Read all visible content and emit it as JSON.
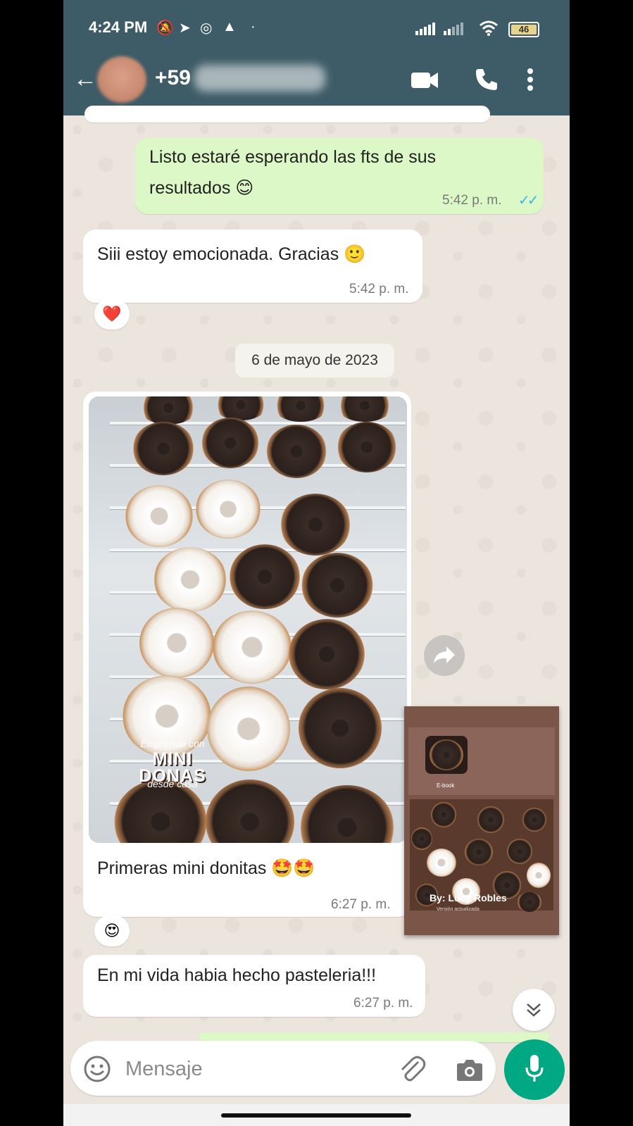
{
  "status_bar": {
    "time": "4:24 PM",
    "battery": "46"
  },
  "header": {
    "contact_prefix": "+59"
  },
  "messages": [
    {
      "text_line1": "Listo estaré esperando las fts de sus",
      "text_line2": "resultados 😊",
      "time": "5:42 p. m.",
      "ticks": "✓✓"
    },
    {
      "text": "Siii estoy emocionada. Gracias 🙂",
      "time": "5:42 p. m.",
      "reaction": "❤️"
    },
    {
      "caption": "Primeras mini donitas 🤩🤩",
      "time": "6:27 p. m.",
      "reaction": "😍"
    },
    {
      "text": "En mi vida habia hecho pasteleria!!!",
      "time": "6:27 p. m."
    }
  ],
  "date_chip": "6 de mayo de 2023",
  "book": {
    "line1": "Emprende con",
    "line2a": "MINI",
    "line2b": "DONAS",
    "line3": "desde casa",
    "ebook": "E-book",
    "author": "By: Lucy Robles",
    "version": "Versión actualizada"
  },
  "input": {
    "placeholder": "Mensaje"
  },
  "colors": {
    "header": "#3E5C67",
    "outgoing": "#DCF8C6",
    "incoming": "#FFFFFF",
    "accent": "#00A884",
    "read_ticks": "#34B7F1"
  },
  "icons": [
    "back-arrow-icon",
    "video-call-icon",
    "phone-icon",
    "more-vert-icon",
    "emoji-icon",
    "attach-icon",
    "camera-icon",
    "mic-icon",
    "forward-icon",
    "chevron-down-icon"
  ]
}
